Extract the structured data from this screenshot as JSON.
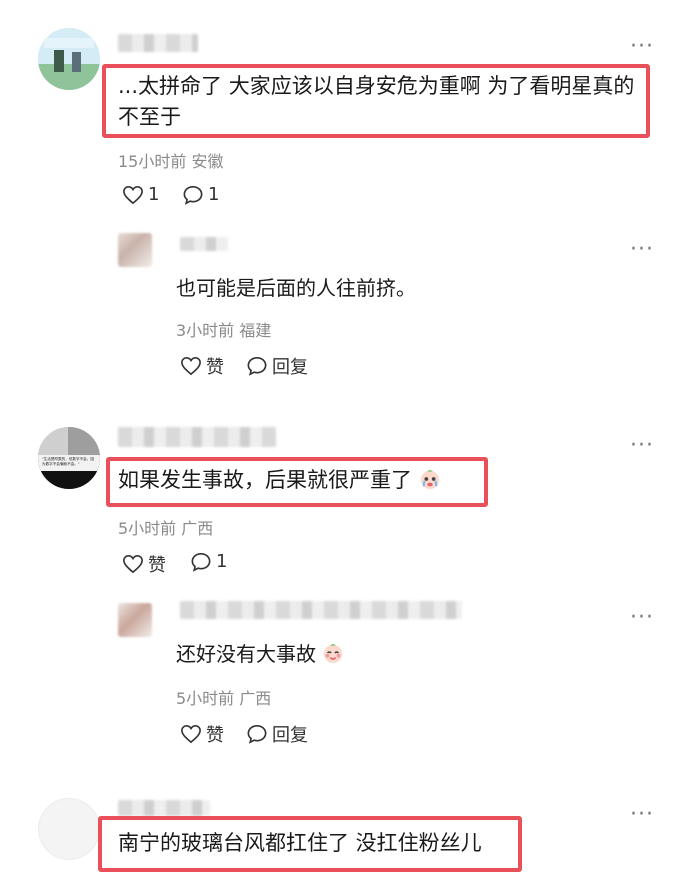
{
  "comments": [
    {
      "text": "...太拼命了 大家应该以自身安危为重啊 为了看明星真的不至于",
      "meta": "15小时前 安徽",
      "like_count": "1",
      "reply_count": "1",
      "reply": {
        "text": "也可能是后面的人往前挤。",
        "meta": "3小时前 福建",
        "like_label": "赞",
        "reply_label": "回复"
      }
    },
    {
      "text": "如果发生事故，后果就很严重了",
      "meta": "5小时前 广西",
      "like_label": "赞",
      "reply_count": "1",
      "reply": {
        "text": "还好没有大事故",
        "meta": "5小时前 广西",
        "like_label": "赞",
        "reply_label": "回复"
      }
    },
    {
      "text": "南宁的玻璃台风都扛住了 没扛住粉丝儿"
    }
  ],
  "avatar2_caption": "\"生活是附属的，但数字不会。因为数字不会骗我不会。\"",
  "colors": {
    "highlight_border": "#e9505a",
    "meta_text": "#8a8a8a"
  }
}
